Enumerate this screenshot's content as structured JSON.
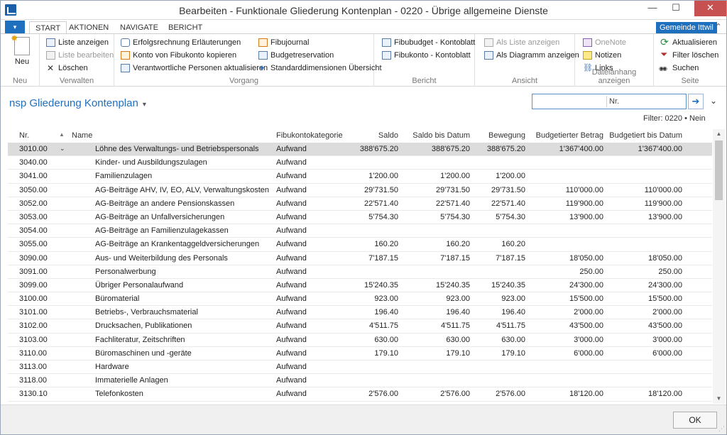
{
  "window": {
    "title": "Bearbeiten - Funktionale Gliederung Kontenplan - 0220 - Übrige allgemeine Dienste",
    "minimize": "—",
    "maximize": "☐",
    "close": "✕"
  },
  "tabs": {
    "file": "▾",
    "items": [
      "START",
      "AKTIONEN",
      "NAVIGATE",
      "BERICHT"
    ],
    "company": "Gemeinde Ittwil",
    "collapse": "⌃"
  },
  "ribbon": {
    "neu": {
      "label": "Neu",
      "group": "Neu"
    },
    "verwalten": {
      "group": "Verwalten",
      "items": [
        "Liste anzeigen",
        "Liste bearbeiten",
        "Löschen"
      ]
    },
    "vorgang": {
      "group": "Vorgang",
      "col1": [
        "Erfolgsrechnung Erläuterungen",
        "Konto von Fibukonto kopieren",
        "Verantwortliche Personen aktualisieren"
      ],
      "col2": [
        "Fibujournal",
        "Budgetreservation",
        "Standarddimensionen Übersicht"
      ]
    },
    "bericht": {
      "group": "Bericht",
      "items": [
        "Fibubudget - Kontoblatt",
        "Fibukonto - Kontoblatt"
      ]
    },
    "ansicht": {
      "group": "Ansicht",
      "items": [
        "Als Liste anzeigen",
        "Als Diagramm anzeigen"
      ]
    },
    "dateianhang": {
      "group": "Dateianhang anzeigen",
      "items": [
        "OneNote",
        "Notizen",
        "Links"
      ]
    },
    "seite": {
      "group": "Seite",
      "items": [
        "Aktualisieren",
        "Filter löschen",
        "Suchen"
      ]
    }
  },
  "page": {
    "title": "nsp Gliederung Kontenplan",
    "title_caret": "▾",
    "search_placeholder": "",
    "search_field": "Nr.",
    "search_go": "➔",
    "expand": "⌄",
    "filter": "Filter: 0220 • Nein"
  },
  "table": {
    "headers": [
      "Nr.",
      "Name",
      "Fibukontokategorie",
      "Saldo",
      "Saldo bis Datum",
      "Bewegung",
      "Budgetierter Betrag",
      "Budgetiert bis Datum"
    ],
    "sort_indicator": "▲",
    "rows": [
      {
        "nr": "3010.00",
        "name": "Löhne des Verwaltungs- und Betriebspersonals",
        "cat": "Aufwand",
        "saldo": "388'675.20",
        "saldod": "388'675.20",
        "bew": "388'675.20",
        "budget": "1'367'400.00",
        "budgetd": "1'367'400.00"
      },
      {
        "nr": "3040.00",
        "name": "Kinder- und Ausbildungszulagen",
        "cat": "Aufwand",
        "saldo": "",
        "saldod": "",
        "bew": "",
        "budget": "",
        "budgetd": ""
      },
      {
        "nr": "3041.00",
        "name": "Familienzulagen",
        "cat": "Aufwand",
        "saldo": "1'200.00",
        "saldod": "1'200.00",
        "bew": "1'200.00",
        "budget": "",
        "budgetd": ""
      },
      {
        "nr": "3050.00",
        "name": "AG-Beiträge AHV, IV, EO, ALV, Verwaltungskosten",
        "cat": "Aufwand",
        "saldo": "29'731.50",
        "saldod": "29'731.50",
        "bew": "29'731.50",
        "budget": "110'000.00",
        "budgetd": "110'000.00"
      },
      {
        "nr": "3052.00",
        "name": "AG-Beiträge an andere Pensionskassen",
        "cat": "Aufwand",
        "saldo": "22'571.40",
        "saldod": "22'571.40",
        "bew": "22'571.40",
        "budget": "119'900.00",
        "budgetd": "119'900.00"
      },
      {
        "nr": "3053.00",
        "name": "AG-Beiträge an Unfallversicherungen",
        "cat": "Aufwand",
        "saldo": "5'754.30",
        "saldod": "5'754.30",
        "bew": "5'754.30",
        "budget": "13'900.00",
        "budgetd": "13'900.00"
      },
      {
        "nr": "3054.00",
        "name": "AG-Beiträge an Familienzulagekassen",
        "cat": "Aufwand",
        "saldo": "",
        "saldod": "",
        "bew": "",
        "budget": "",
        "budgetd": ""
      },
      {
        "nr": "3055.00",
        "name": "AG-Beiträge an Krankentaggeldversicherungen",
        "cat": "Aufwand",
        "saldo": "160.20",
        "saldod": "160.20",
        "bew": "160.20",
        "budget": "",
        "budgetd": ""
      },
      {
        "nr": "3090.00",
        "name": "Aus- und Weiterbildung des Personals",
        "cat": "Aufwand",
        "saldo": "7'187.15",
        "saldod": "7'187.15",
        "bew": "7'187.15",
        "budget": "18'050.00",
        "budgetd": "18'050.00"
      },
      {
        "nr": "3091.00",
        "name": "Personalwerbung",
        "cat": "Aufwand",
        "saldo": "",
        "saldod": "",
        "bew": "",
        "budget": "250.00",
        "budgetd": "250.00"
      },
      {
        "nr": "3099.00",
        "name": "Übriger Personalaufwand",
        "cat": "Aufwand",
        "saldo": "15'240.35",
        "saldod": "15'240.35",
        "bew": "15'240.35",
        "budget": "24'300.00",
        "budgetd": "24'300.00"
      },
      {
        "nr": "3100.00",
        "name": "Büromaterial",
        "cat": "Aufwand",
        "saldo": "923.00",
        "saldod": "923.00",
        "bew": "923.00",
        "budget": "15'500.00",
        "budgetd": "15'500.00"
      },
      {
        "nr": "3101.00",
        "name": "Betriebs-, Verbrauchsmaterial",
        "cat": "Aufwand",
        "saldo": "196.40",
        "saldod": "196.40",
        "bew": "196.40",
        "budget": "2'000.00",
        "budgetd": "2'000.00"
      },
      {
        "nr": "3102.00",
        "name": "Drucksachen, Publikationen",
        "cat": "Aufwand",
        "saldo": "4'511.75",
        "saldod": "4'511.75",
        "bew": "4'511.75",
        "budget": "43'500.00",
        "budgetd": "43'500.00"
      },
      {
        "nr": "3103.00",
        "name": "Fachliteratur, Zeitschriften",
        "cat": "Aufwand",
        "saldo": "630.00",
        "saldod": "630.00",
        "bew": "630.00",
        "budget": "3'000.00",
        "budgetd": "3'000.00"
      },
      {
        "nr": "3110.00",
        "name": "Büromaschinen und -geräte",
        "cat": "Aufwand",
        "saldo": "179.10",
        "saldod": "179.10",
        "bew": "179.10",
        "budget": "6'000.00",
        "budgetd": "6'000.00"
      },
      {
        "nr": "3113.00",
        "name": "Hardware",
        "cat": "Aufwand",
        "saldo": "",
        "saldod": "",
        "bew": "",
        "budget": "",
        "budgetd": ""
      },
      {
        "nr": "3118.00",
        "name": "Immaterielle Anlagen",
        "cat": "Aufwand",
        "saldo": "",
        "saldod": "",
        "bew": "",
        "budget": "",
        "budgetd": ""
      },
      {
        "nr": "3130.10",
        "name": "Telefonkosten",
        "cat": "Aufwand",
        "saldo": "2'576.00",
        "saldod": "2'576.00",
        "bew": "2'576.00",
        "budget": "18'120.00",
        "budgetd": "18'120.00"
      }
    ],
    "row_caret": "⌄"
  },
  "scroll": {
    "up": "▲",
    "down": "▼"
  },
  "footer": {
    "ok": "OK",
    "grip": "⋰"
  }
}
